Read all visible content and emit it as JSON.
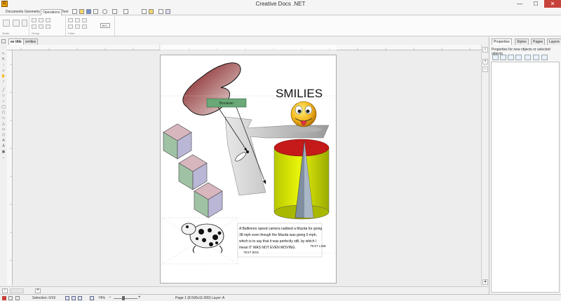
{
  "window": {
    "title": "Creative Docs .NET",
    "minimize": "—",
    "maximize": "☐",
    "close": "✕"
  },
  "ribbon_tabs": [
    "Documents",
    "Geometry",
    "Operations",
    "Text"
  ],
  "ribbon": {
    "groups": [
      "Order",
      "Group",
      "Color"
    ],
    "zoom_value": "15.0"
  },
  "doc_tabs": [
    "ee title",
    "smilies"
  ],
  "panel": {
    "tabs": [
      "Properties",
      "Styles",
      "Pages",
      "Layers"
    ],
    "info": "Properties for new objects or selected objects"
  },
  "drawing": {
    "heading": "SMILIES",
    "boolean_label": "Boolean",
    "paragraph": [
      "A Baltimore speed camera nabbed a Mazda for going",
      "38 mph even though the Mazda was going 0 mph,",
      "which is to say that it was perfectly still, by which I",
      "mean IT WAS NOT EVEN MOVING."
    ],
    "text_line": "TEXT LINE",
    "text_box": "TEXT BOX"
  },
  "status": {
    "selection": "Selection: 0/19",
    "zoom": "74%",
    "page_info": "Page 1 (8.500x11.000) Layer: A"
  },
  "colors": {
    "accent": "#c7423a",
    "cylinder_body": "#d7ea00",
    "cylinder_top": "#c41a1a",
    "blob": "#8e1a1a",
    "boolean": "#6aa878"
  }
}
